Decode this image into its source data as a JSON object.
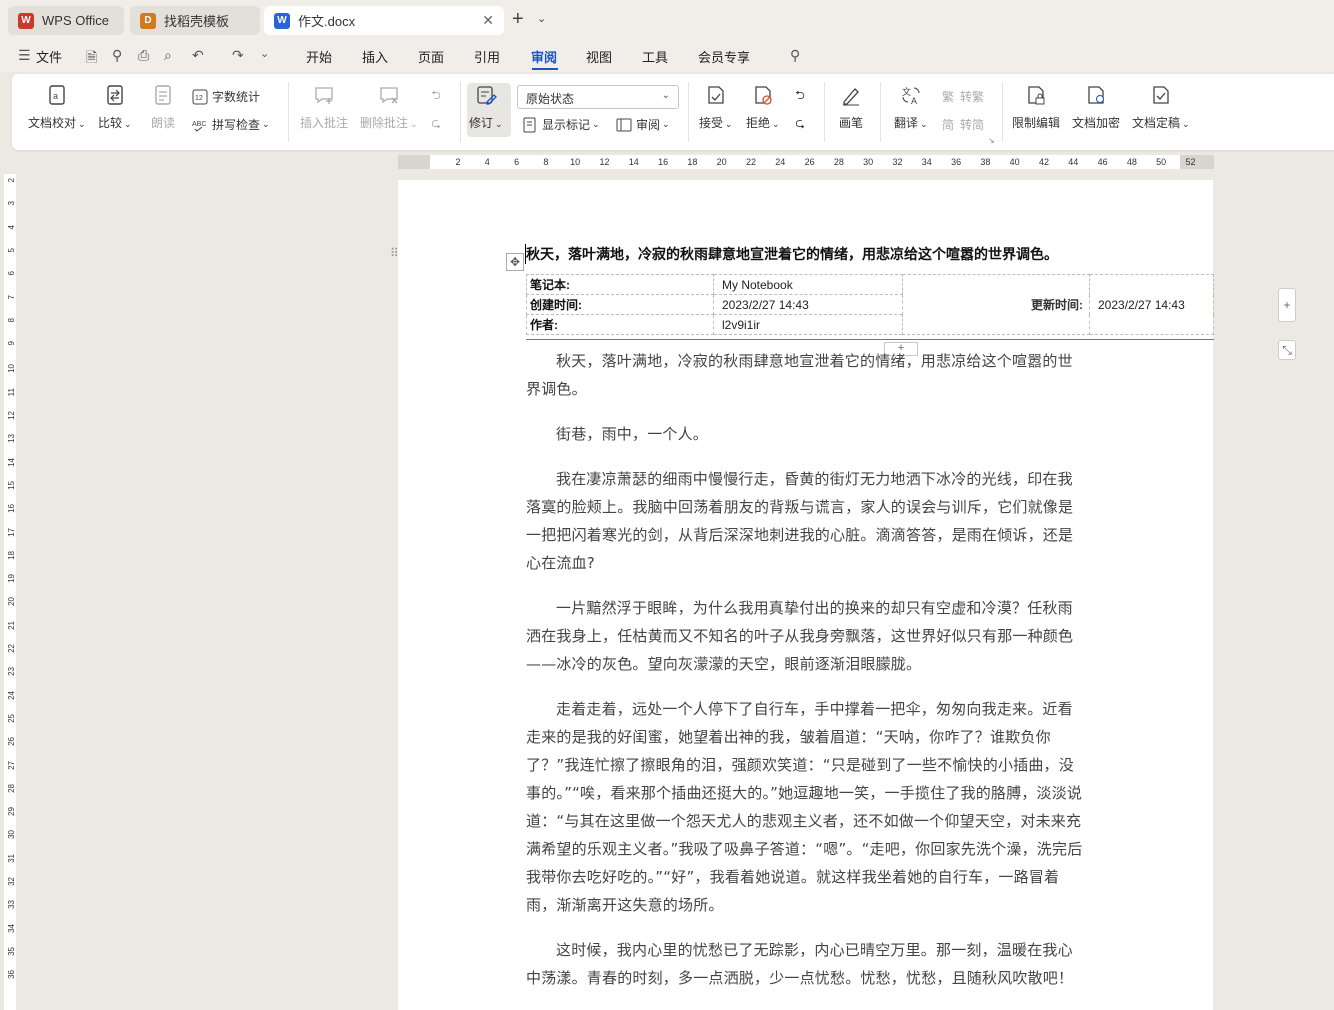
{
  "tabs": [
    {
      "label": "WPS Office",
      "icon": "wps-logo-icon",
      "color": "#c93a2a"
    },
    {
      "label": "找稻壳模板",
      "icon": "docer-logo-icon",
      "color": "#d6781e"
    },
    {
      "label": "作文.docx",
      "icon": "word-doc-icon",
      "color": "#2b63d9"
    }
  ],
  "menu": {
    "file": "文件",
    "items": [
      "开始",
      "插入",
      "页面",
      "引用",
      "审阅",
      "视图",
      "工具",
      "会员专享"
    ],
    "active": "审阅"
  },
  "ribbon": {
    "proofread": "文档校对",
    "compare": "比较",
    "read_aloud": "朗读",
    "word_count": "字数统计",
    "spell_check": "拼写检查",
    "insert_comment": "插入批注",
    "delete_comment": "删除批注",
    "revise": "修订",
    "state_select": "原始状态",
    "show_markup": "显示标记",
    "review": "审阅",
    "accept": "接受",
    "reject": "拒绝",
    "pen": "画笔",
    "translate": "翻译",
    "to_traditional": "转繁",
    "to_simplified": "转简",
    "restrict_edit": "限制编辑",
    "encrypt": "文档加密",
    "finalize": "文档定稿"
  },
  "ruler_ticks": [
    "2",
    "4",
    "6",
    "8",
    "10",
    "12",
    "14",
    "16",
    "18",
    "20",
    "22",
    "24",
    "26",
    "28",
    "30",
    "32",
    "34",
    "36",
    "38",
    "40",
    "42",
    "44",
    "46",
    "48",
    "50",
    "52"
  ],
  "vruler_ticks": [
    "2",
    "3",
    "4",
    "5",
    "6",
    "7",
    "8",
    "9",
    "10",
    "11",
    "12",
    "13",
    "14",
    "15",
    "16",
    "17",
    "18",
    "19",
    "20",
    "21",
    "22",
    "23",
    "24",
    "25",
    "26",
    "27",
    "28",
    "29",
    "30",
    "31",
    "32",
    "33",
    "34",
    "35",
    "36"
  ],
  "document": {
    "title": "秋天，落叶满地，冷寂的秋雨肆意地宣泄着它的情绪，用悲凉给这个喧嚣的世界调色。",
    "meta": {
      "notebook_label": "笔记本:",
      "notebook_value": "My Notebook",
      "created_label": "创建时间:",
      "created_value": "2023/2/27 14:43",
      "updated_label": "更新时间:",
      "updated_value": "2023/2/27 14:43",
      "author_label": "作者:",
      "author_value": "l2v9i1ir"
    },
    "paragraphs": [
      "秋天，落叶满地，冷寂的秋雨肆意地宣泄着它的情绪，用悲凉给这个喧嚣的世界调色。",
      "街巷，雨中，一个人。",
      "我在凄凉萧瑟的细雨中慢慢行走，昏黄的街灯无力地洒下冰冷的光线，印在我落寞的脸颊上。我脑中回荡着朋友的背叛与谎言，家人的误会与训斥，它们就像是一把把闪着寒光的剑，从背后深深地刺进我的心脏。滴滴答答，是雨在倾诉，还是心在流血?",
      "一片黯然浮于眼眸，为什么我用真挚付出的换来的却只有空虚和冷漠？任秋雨洒在我身上，任枯黄而又不知名的叶子从我身旁飘落，这世界好似只有那一种颜色——冰冷的灰色。望向灰濛濛的天空，眼前逐渐泪眼朦胧。",
      "走着走着，远处一个人停下了自行车，手中撑着一把伞，匆匆向我走来。近看走来的是我的好闺蜜，她望着出神的我，皱着眉道：“天呐，你咋了？谁欺负你了？”我连忙擦了擦眼角的泪，强颜欢笑道：“只是碰到了一些不愉快的小插曲，没事的。”“唉，看来那个插曲还挺大的。”她逗趣地一笑，一手揽住了我的胳膊，淡淡说道：“与其在这里做一个怨天尤人的悲观主义者，还不如做一个仰望天空，对未来充满希望的乐观主义者。”我吸了吸鼻子答道：“嗯”。“走吧，你回家先洗个澡，洗完后我带你去吃好吃的。”“好”，我看着她说道。就这样我坐着她的自行车，一路冒着雨，渐渐离开这失意的场所。",
      "这时候，我内心里的忧愁已了无踪影，内心已晴空万里。那一刻，温暖在我心中荡漾。青春的时刻，多一点洒脱，少一点忧愁。忧愁，忧愁，且随秋风吹散吧！"
    ]
  },
  "colors": {
    "accent": "#1a55c4",
    "background": "#ece8e2"
  }
}
